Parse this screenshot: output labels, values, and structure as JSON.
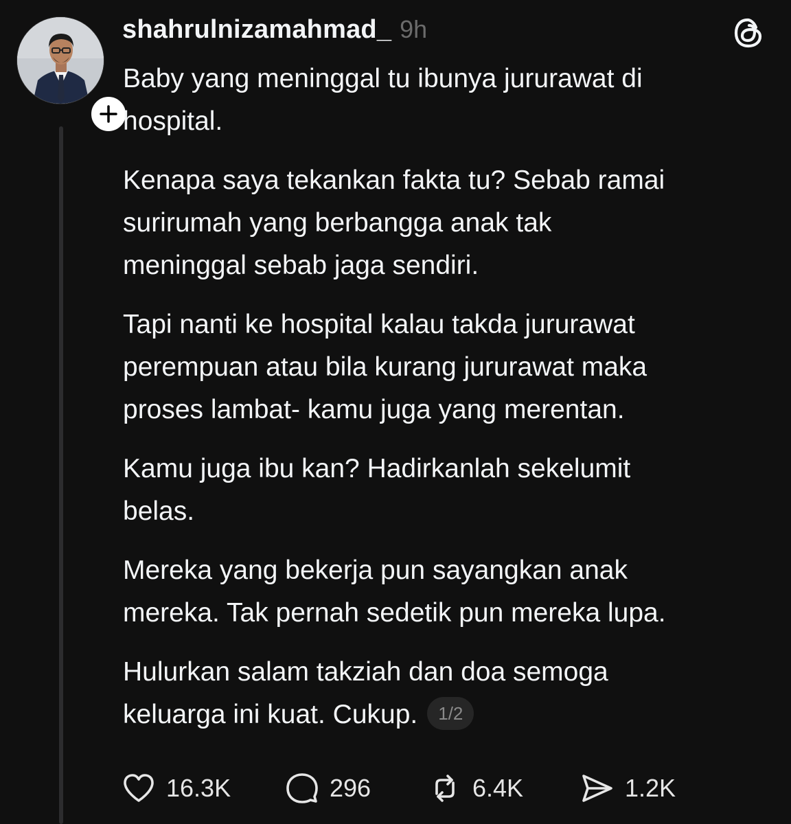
{
  "post": {
    "username": "shahrulnizamahmad_",
    "time": "9h",
    "paragraphs": [
      "Baby yang meninggal tu ibunya jururawat di\nhospital.",
      "Kenapa saya tekankan fakta tu? Sebab ramai\nsurirumah yang berbangga anak tak\nmeninggal sebab jaga sendiri.",
      "Tapi nanti ke hospital kalau takda jururawat\nperempuan atau bila kurang jururawat maka\nproses lambat- kamu juga yang merentan.",
      "Kamu juga ibu kan? Hadirkanlah sekelumit\nbelas.",
      "Mereka yang bekerja pun sayangkan anak\nmereka. Tak pernah sedetik pun mereka lupa.",
      "Hulurkan salam takziah dan doa semoga\nkeluarga ini kuat. Cukup."
    ],
    "page_indicator": "1/2"
  },
  "actions": {
    "likes": "16.3K",
    "replies": "296",
    "reposts": "6.4K",
    "shares": "1.2K"
  },
  "icons": {
    "avatar": "profile-photo",
    "follow": "plus-icon",
    "brand": "threads-logo-icon",
    "like": "heart-icon",
    "reply": "comment-bubble-icon",
    "repost": "repost-icon",
    "share": "send-icon"
  },
  "colors": {
    "background": "#101010",
    "text": "#f3f5f7",
    "muted": "#6b6b6b",
    "thread_line": "#2c2c2e"
  }
}
